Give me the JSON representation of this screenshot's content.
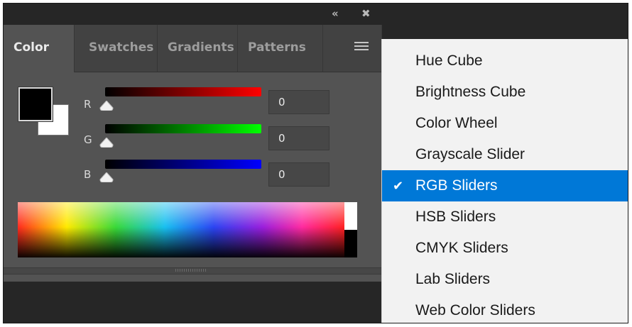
{
  "window_controls": {
    "collapse_icon": "double-chevron-left-icon",
    "close_icon": "close-icon"
  },
  "tabs": [
    {
      "label": "Color",
      "active": true
    },
    {
      "label": "Swatches",
      "active": false
    },
    {
      "label": "Gradients",
      "active": false
    },
    {
      "label": "Patterns",
      "active": false
    }
  ],
  "panel_menu_icon": "hamburger-menu-icon",
  "swatches": {
    "foreground": "#000000",
    "background": "#ffffff"
  },
  "channels": [
    {
      "label": "R",
      "value": "0",
      "slider_level": 0,
      "gradient_end": "#ff0000"
    },
    {
      "label": "G",
      "value": "0",
      "slider_level": 0,
      "gradient_end": "#00ff00"
    },
    {
      "label": "B",
      "value": "0",
      "slider_level": 0,
      "gradient_end": "#0000ff"
    }
  ],
  "menu": {
    "items": [
      {
        "label": "Hue Cube",
        "selected": false
      },
      {
        "label": "Brightness Cube",
        "selected": false
      },
      {
        "label": "Color Wheel",
        "selected": false
      },
      {
        "label": "Grayscale Slider",
        "selected": false
      },
      {
        "label": "RGB Sliders",
        "selected": true
      },
      {
        "label": "HSB Sliders",
        "selected": false
      },
      {
        "label": "CMYK Sliders",
        "selected": false
      },
      {
        "label": "Lab Sliders",
        "selected": false
      },
      {
        "label": "Web Color Sliders",
        "selected": false
      }
    ],
    "checkmark": "✔",
    "highlight_color": "#0078d7"
  }
}
